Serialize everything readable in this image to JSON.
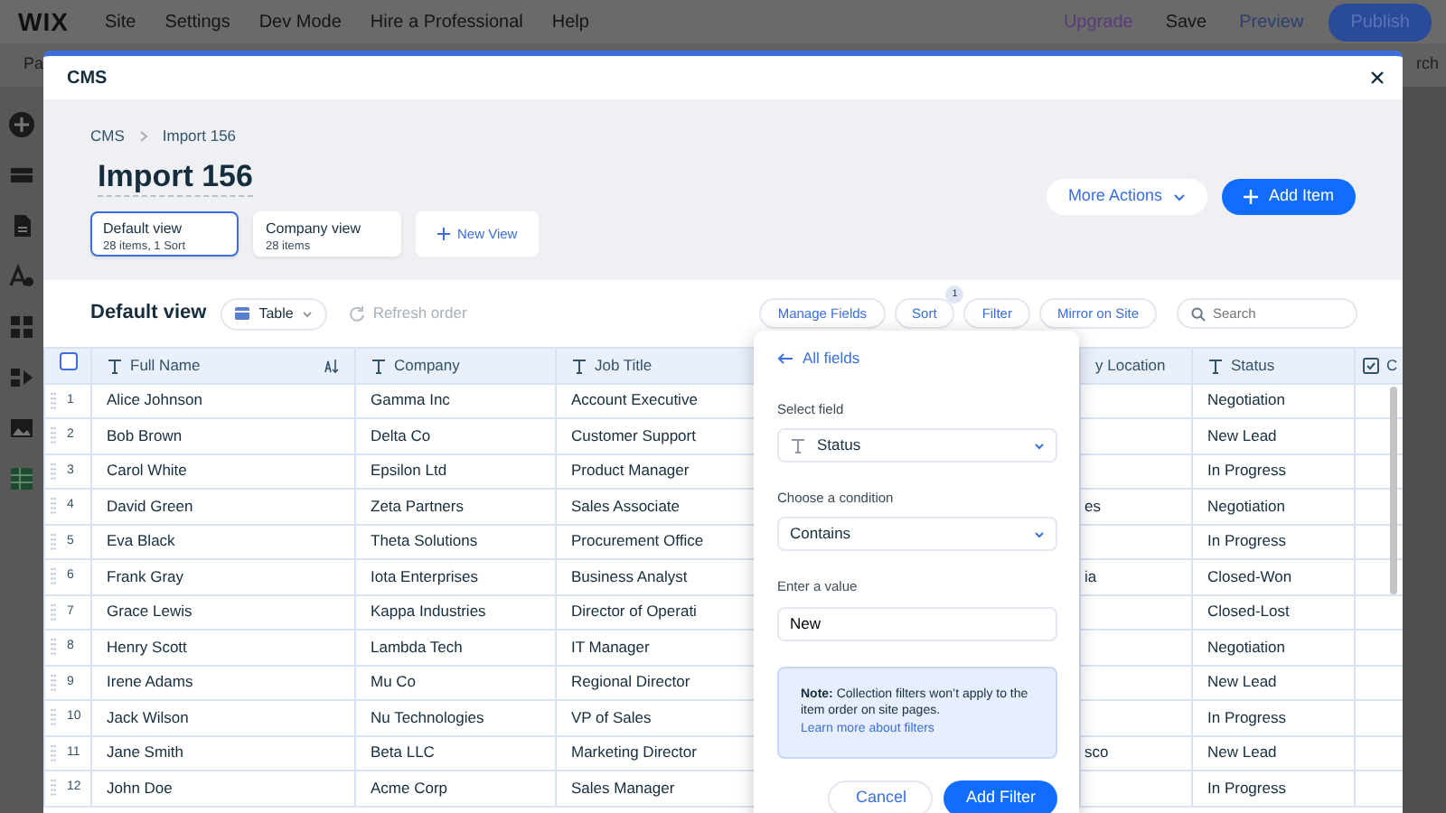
{
  "editor": {
    "logo": "WIX",
    "menu": [
      "Site",
      "Settings",
      "Dev Mode",
      "Hire a Professional",
      "Help"
    ],
    "actions": [
      {
        "label": "Upgrade",
        "kind": "upgrade"
      },
      {
        "label": "Save",
        "kind": "plain"
      },
      {
        "label": "Preview",
        "kind": "preview"
      },
      {
        "label": "Publish",
        "kind": "primary"
      }
    ],
    "toolbar_left": "Pa",
    "toolbar_right": "rch"
  },
  "cms": {
    "title": "CMS",
    "breadcrumb": [
      "CMS",
      "Import 156"
    ],
    "heading": "Import 156",
    "views": [
      {
        "name": "Default view",
        "meta": "28 items, 1 Sort",
        "selected": true
      },
      {
        "name": "Company view",
        "meta": "28 items",
        "selected": false
      }
    ],
    "new_view": "New View",
    "more_actions": "More Actions",
    "add_item": "Add Item",
    "view_title": "Default view",
    "layout": "Table",
    "refresh": "Refresh order",
    "tools": [
      {
        "label": "Manage Fields"
      },
      {
        "label": "Sort",
        "badge": "1"
      },
      {
        "label": "Filter"
      },
      {
        "label": "Mirror on Site"
      }
    ],
    "search": {
      "placeholder": "Search"
    },
    "table": {
      "select_all": {
        "checked": false
      },
      "columns": [
        {
          "label": "Full Name",
          "kind": "text",
          "sorted": true
        },
        {
          "label": "Company",
          "kind": "text",
          "sorted": false
        },
        {
          "label": "Job Title",
          "kind": "text",
          "sorted": false
        },
        {
          "label": "y Location",
          "sorted": false
        },
        {
          "label": "Status",
          "kind": "text",
          "sorted": false
        },
        {
          "label": "C",
          "kind": "boolean"
        }
      ],
      "rows": [
        {
          "number": "1",
          "cells": [
            "Alice Johnson",
            "Gamma Inc",
            "Account Executive",
            "",
            "Negotiation",
            ""
          ]
        },
        {
          "number": "2",
          "cells": [
            "Bob Brown",
            "Delta Co",
            "Customer Support",
            "",
            "New Lead",
            ""
          ]
        },
        {
          "number": "3",
          "cells": [
            "Carol White",
            "Epsilon Ltd",
            "Product Manager",
            "",
            "In Progress",
            ""
          ]
        },
        {
          "number": "4",
          "cells": [
            "David Green",
            "Zeta Partners",
            "Sales Associate",
            "es",
            "Negotiation",
            ""
          ]
        },
        {
          "number": "5",
          "cells": [
            "Eva Black",
            "Theta Solutions",
            "Procurement Office",
            "",
            "In Progress",
            ""
          ]
        },
        {
          "number": "6",
          "cells": [
            "Frank Gray",
            "Iota Enterprises",
            "Business Analyst",
            "ia",
            "Closed-Won",
            ""
          ]
        },
        {
          "number": "7",
          "cells": [
            "Grace Lewis",
            "Kappa Industries",
            "Director of Operati",
            "",
            "Closed-Lost",
            ""
          ]
        },
        {
          "number": "8",
          "cells": [
            "Henry Scott",
            "Lambda Tech",
            "IT Manager",
            "",
            "Negotiation",
            ""
          ]
        },
        {
          "number": "9",
          "cells": [
            "Irene Adams",
            "Mu Co",
            "Regional Director",
            "",
            "New Lead",
            ""
          ]
        },
        {
          "number": "10",
          "cells": [
            "Jack Wilson",
            "Nu Technologies",
            "VP of Sales",
            "",
            "In Progress",
            ""
          ]
        },
        {
          "number": "11",
          "cells": [
            "Jane Smith",
            "Beta LLC",
            "Marketing Director",
            "sco",
            "New Lead",
            ""
          ]
        },
        {
          "number": "12",
          "cells": [
            "John Doe",
            "Acme Corp",
            "Sales Manager",
            "",
            "In Progress",
            ""
          ]
        }
      ]
    },
    "filter_popover": {
      "back": "All fields",
      "field_label": "Select field",
      "field_value": "Status",
      "condition_label": "Choose a condition",
      "condition_value": "Contains",
      "value_label": "Enter a value",
      "value": "New",
      "note": "**Note:** Collection filters won’t apply to the item order on site pages.",
      "note_link": "Learn more about filters",
      "cancel": "Cancel",
      "submit": "Add Filter"
    }
  }
}
